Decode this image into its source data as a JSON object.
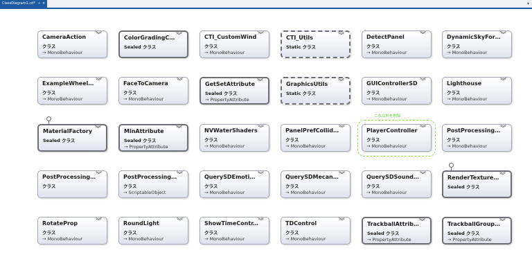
{
  "tab": {
    "title": "ClassDiagram1.cd*",
    "pin_icon": "pin-icon",
    "close_icon": "close-icon"
  },
  "dropdown_icon": "chevron-down-icon",
  "highlight_label": "これ以外を削除",
  "arrow": "⊸",
  "cards": [
    {
      "name": "CameraAction",
      "kind": "クラス",
      "base": "MonoBehaviour",
      "style": "normal"
    },
    {
      "name": "ColorGradingCur...",
      "kind": "Sealed クラス",
      "base": "",
      "style": "sealed"
    },
    {
      "name": "CTI_CustomWind",
      "kind": "クラス",
      "base": "MonoBehaviour",
      "style": "normal"
    },
    {
      "name": "CTI_Utils",
      "kind": "Static クラス",
      "base": "",
      "style": "static"
    },
    {
      "name": "DetectPanel",
      "kind": "クラス",
      "base": "MonoBehaviour",
      "style": "normal"
    },
    {
      "name": "DynamicSkyForD...",
      "kind": "クラス",
      "base": "MonoBehaviour",
      "style": "normal"
    },
    {
      "name": "ExampleWheelC...",
      "kind": "クラス",
      "base": "MonoBehaviour",
      "style": "normal"
    },
    {
      "name": "FaceToCamera",
      "kind": "クラス",
      "base": "MonoBehaviour",
      "style": "normal"
    },
    {
      "name": "GetSetAttribute",
      "kind": "Sealed クラス",
      "base": "PropertyAttribute",
      "style": "sealed"
    },
    {
      "name": "GraphicsUtils",
      "kind": "Static クラス",
      "base": "",
      "style": "static"
    },
    {
      "name": "GUIControllerSD",
      "kind": "クラス",
      "base": "MonoBehaviour",
      "style": "normal"
    },
    {
      "name": "Lighthouse",
      "kind": "クラス",
      "base": "MonoBehaviour",
      "style": "normal"
    },
    {
      "name": "MaterialFactory",
      "kind": "Sealed クラス",
      "base": "",
      "style": "sealed"
    },
    {
      "name": "MinAttribute",
      "kind": "Sealed クラス",
      "base": "PropertyAttribute",
      "style": "sealed"
    },
    {
      "name": "NVWaterShaders",
      "kind": "クラス",
      "base": "MonoBehaviour",
      "style": "normal"
    },
    {
      "name": "PanelPrefCollider",
      "kind": "クラス",
      "base": "MonoBehaviour",
      "style": "normal"
    },
    {
      "name": "PlayerController",
      "kind": "クラス",
      "base": "MonoBehaviour",
      "style": "normal"
    },
    {
      "name": "PostProcessingB...",
      "kind": "クラス",
      "base": "MonoBehaviour",
      "style": "normal"
    },
    {
      "name": "PostProcessingC...",
      "kind": "クラス",
      "base": "",
      "style": "normal"
    },
    {
      "name": "PostProcessingPr...",
      "kind": "クラス",
      "base": "ScriptableObject",
      "style": "normal"
    },
    {
      "name": "QuerySDEmotion...",
      "kind": "クラス",
      "base": "MonoBehaviour",
      "style": "normal"
    },
    {
      "name": "QuerySDMecani...",
      "kind": "クラス",
      "base": "MonoBehaviour",
      "style": "normal"
    },
    {
      "name": "QuerySDSoundC...",
      "kind": "クラス",
      "base": "MonoBehaviour",
      "style": "normal"
    },
    {
      "name": "RenderTextureFa...",
      "kind": "Sealed クラス",
      "base": "",
      "style": "sealed"
    },
    {
      "name": "RotateProp",
      "kind": "クラス",
      "base": "MonoBehaviour",
      "style": "normal"
    },
    {
      "name": "RoundLight",
      "kind": "クラス",
      "base": "MonoBehaviour",
      "style": "normal"
    },
    {
      "name": "ShowTimeContr...",
      "kind": "クラス",
      "base": "MonoBehaviour",
      "style": "normal"
    },
    {
      "name": "TDControl",
      "kind": "クラス",
      "base": "MonoBehaviour",
      "style": "normal"
    },
    {
      "name": "TrackballAttribute",
      "kind": "Sealed クラス",
      "base": "PropertyAttribute",
      "style": "sealed"
    },
    {
      "name": "TrackballGroupA...",
      "kind": "Sealed クラス",
      "base": "PropertyAttribute",
      "style": "sealed"
    }
  ]
}
